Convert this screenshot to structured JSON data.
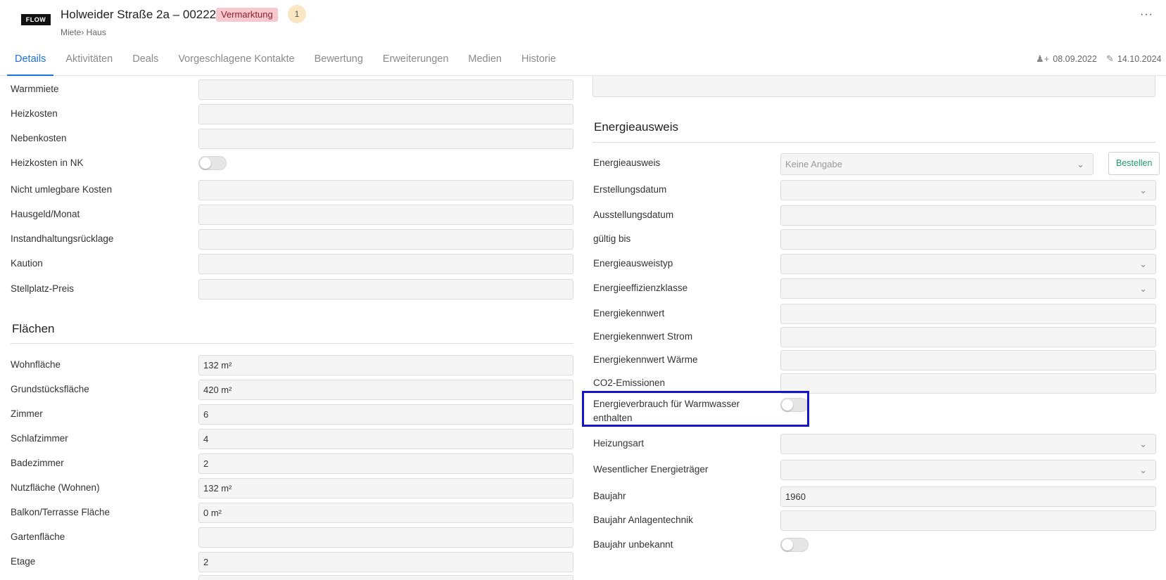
{
  "header": {
    "logo": "FLOW",
    "title": "Holweider Straße 2a – 002222",
    "status_badge": "Vermarktung",
    "count_badge": "1",
    "subtitle": "Miete› Haus",
    "more_icon": "more-horizontal-icon",
    "created_date": "08.09.2022",
    "edited_date": "14.10.2024",
    "status_color": "#f7c9cf",
    "accent_color": "#1e6fd9"
  },
  "tabs": [
    {
      "label": "Details",
      "active": true
    },
    {
      "label": "Aktivitäten"
    },
    {
      "label": "Deals"
    },
    {
      "label": "Vorgeschlagene Kontakte"
    },
    {
      "label": "Bewertung"
    },
    {
      "label": "Erweiterungen"
    },
    {
      "label": "Medien"
    },
    {
      "label": "Historie"
    }
  ],
  "left": {
    "costs": [
      {
        "label": "Warmmiete",
        "value": ""
      },
      {
        "label": "Heizkosten",
        "value": ""
      },
      {
        "label": "Nebenkosten",
        "value": ""
      },
      {
        "label": "Heizkosten in NK",
        "toggle": false
      },
      {
        "label": "Nicht umlegbare Kosten",
        "value": ""
      },
      {
        "label": "Hausgeld/Monat",
        "value": ""
      },
      {
        "label": "Instandhaltungsrücklage",
        "value": ""
      },
      {
        "label": "Kaution",
        "value": ""
      },
      {
        "label": "Stellplatz-Preis",
        "value": ""
      }
    ],
    "flaechen_title": "Flächen",
    "flaechen": [
      {
        "label": "Wohnfläche",
        "value": "132 m²"
      },
      {
        "label": "Grundstücksfläche",
        "value": "420 m²"
      },
      {
        "label": "Zimmer",
        "value": "6"
      },
      {
        "label": "Schlafzimmer",
        "value": "4"
      },
      {
        "label": "Badezimmer",
        "value": "2"
      },
      {
        "label": "Nutzfläche (Wohnen)",
        "value": "132 m²"
      },
      {
        "label": "Balkon/Terrasse Fläche",
        "value": "0 m²"
      },
      {
        "label": "Gartenfläche",
        "value": ""
      },
      {
        "label": "Etage",
        "value": "2"
      }
    ]
  },
  "right": {
    "section_title": "Energieausweis",
    "energieausweis": {
      "label": "Energieausweis",
      "value": "Keine Angabe",
      "button": "Bestellen"
    },
    "rows": [
      {
        "label": "Erstellungsdatum",
        "value": "",
        "select": true
      },
      {
        "label": "Ausstellungsdatum",
        "value": ""
      },
      {
        "label": "gültig bis",
        "value": ""
      },
      {
        "label": "Energieausweistyp",
        "value": "",
        "select": true
      },
      {
        "label": "Energieeffizienzklasse",
        "value": "",
        "select": true
      },
      {
        "label": "Energiekennwert",
        "value": ""
      },
      {
        "label": "Energiekennwert Strom",
        "value": ""
      },
      {
        "label": "Energiekennwert Wärme",
        "value": ""
      },
      {
        "label": "CO2-Emissionen",
        "value": ""
      }
    ],
    "warmwasser": {
      "label_line1": "Energieverbrauch für Warmwasser",
      "label_line2": "enthalten",
      "toggle": false
    },
    "rows2": [
      {
        "label": "Heizungsart",
        "value": "",
        "select": true
      },
      {
        "label": "Wesentlicher Energieträger",
        "value": "",
        "select": true
      },
      {
        "label": "Baujahr",
        "value": "1960"
      },
      {
        "label": "Baujahr Anlagentechnik",
        "value": ""
      }
    ],
    "baujahr_unbekannt": {
      "label": "Baujahr unbekannt",
      "toggle": false
    }
  }
}
